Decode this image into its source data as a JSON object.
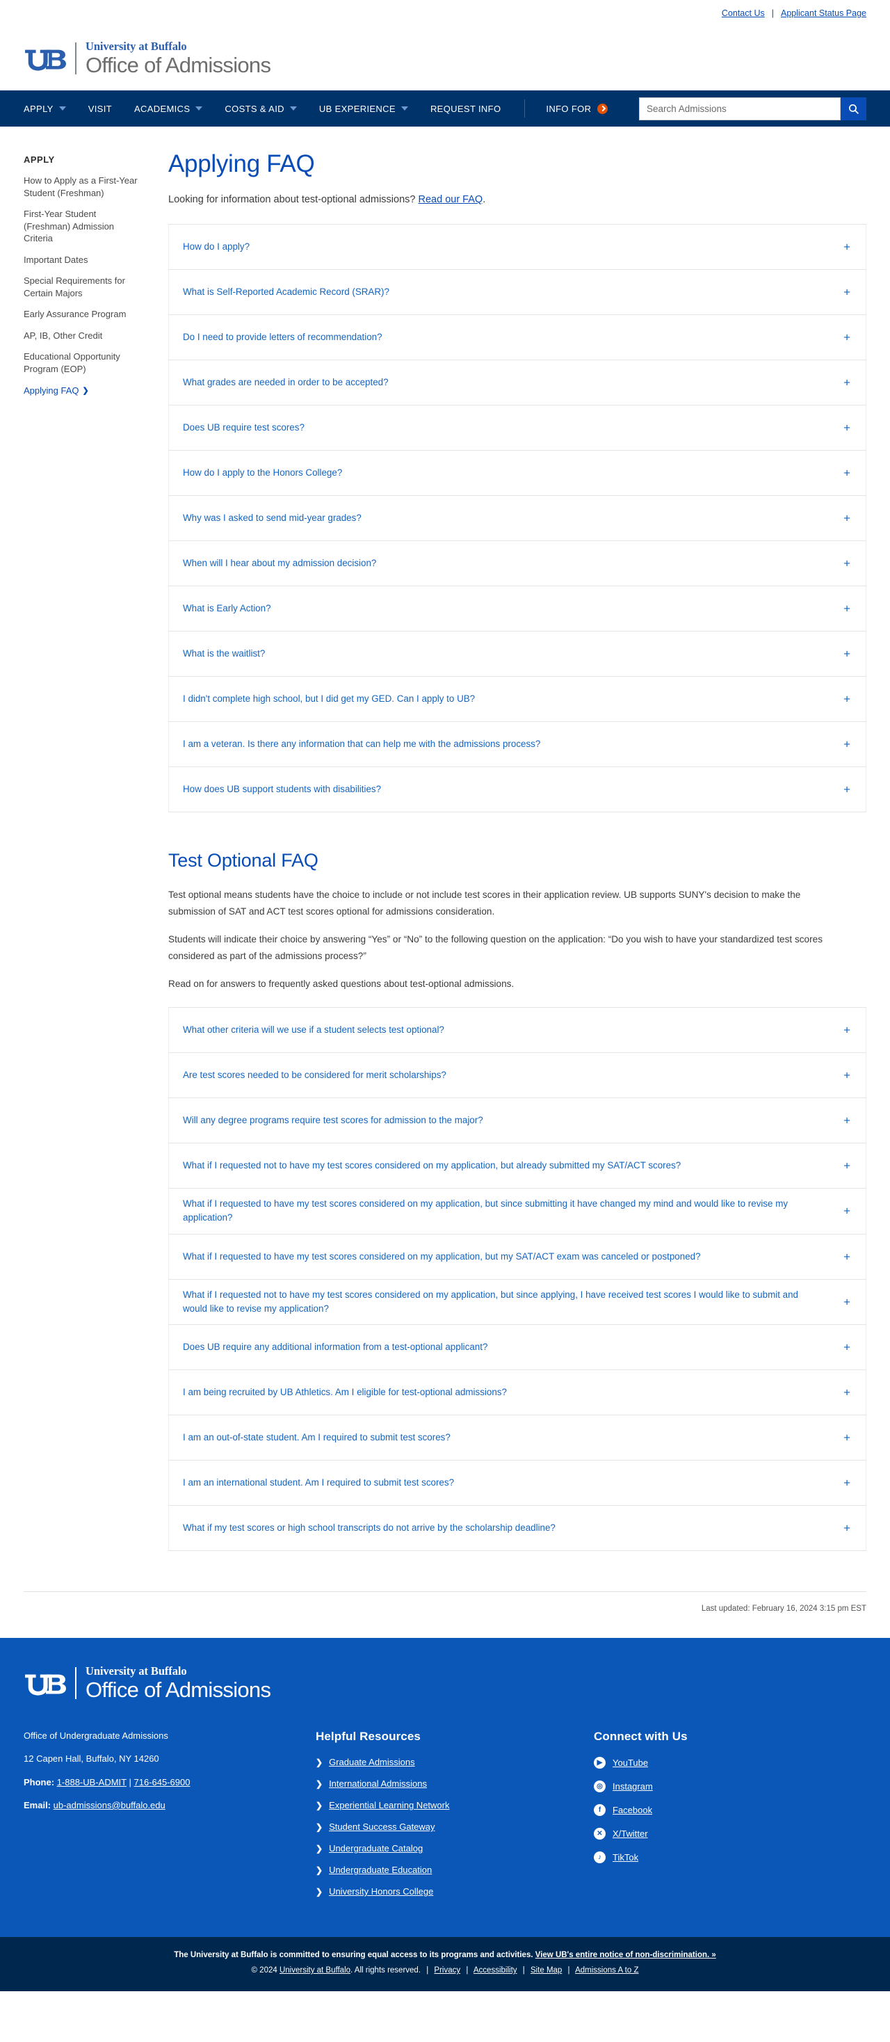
{
  "utility": {
    "contact_us": "Contact Us",
    "separator": "|",
    "applicant_status": "Applicant Status Page"
  },
  "brand": {
    "university": "University at Buffalo",
    "unit": "Office of Admissions"
  },
  "nav": {
    "items": [
      {
        "label": "APPLY",
        "has_caret": true
      },
      {
        "label": "VISIT",
        "has_caret": false
      },
      {
        "label": "ACADEMICS",
        "has_caret": true
      },
      {
        "label": "COSTS & AID",
        "has_caret": true
      },
      {
        "label": "UB EXPERIENCE",
        "has_caret": true
      },
      {
        "label": "REQUEST INFO",
        "has_caret": false
      }
    ],
    "info_for": "INFO FOR",
    "search_placeholder": "Search Admissions"
  },
  "sidebar": {
    "title": "APPLY",
    "items": [
      {
        "label": "How to Apply as a First-Year Student (Freshman)",
        "active": false
      },
      {
        "label": "First-Year Student (Freshman) Admission Criteria",
        "active": false
      },
      {
        "label": "Important Dates",
        "active": false
      },
      {
        "label": "Special Requirements for Certain Majors",
        "active": false
      },
      {
        "label": "Early Assurance Program",
        "active": false
      },
      {
        "label": "AP, IB, Other Credit",
        "active": false
      },
      {
        "label": "Educational Opportunity Program (EOP)",
        "active": false
      },
      {
        "label": "Applying FAQ",
        "active": true
      }
    ]
  },
  "main": {
    "page_title": "Applying FAQ",
    "lead_prefix": "Looking for information about test-optional admissions?",
    "lead_link": "Read our FAQ",
    "lead_suffix": ".",
    "applying_faq": [
      "How do I apply?",
      "What is Self-Reported Academic Record (SRAR)?",
      "Do I need to provide letters of recommendation?",
      "What grades are needed in order to be accepted?",
      "Does UB require test scores?",
      "How do I apply to the Honors College?",
      "Why was I asked to send mid-year grades?",
      "When will I hear about my admission decision?",
      "What is Early Action?",
      "What is the waitlist?",
      "I didn't complete high school, but I did get my GED. Can I apply to UB?",
      "I am a veteran. Is there any information that can help me with the admissions process?",
      "How does UB support students with disabilities?"
    ],
    "test_optional_title": "Test Optional FAQ",
    "test_optional_paragraphs": [
      "Test optional means students have the choice to include or not include test scores in their application review. UB supports SUNY's decision to make the submission of SAT and ACT test scores optional for admissions consideration.",
      "Students will indicate their choice by answering “Yes” or “No” to the following question on the application: “Do you wish to have your standardized test scores considered as part of the admissions process?”",
      "Read on for answers to frequently asked questions about test-optional admissions."
    ],
    "test_optional_faq": [
      "What other criteria will we use if a student selects test optional?",
      "Are test scores needed to be considered for merit scholarships?",
      "Will any degree programs require test scores for admission to the major?",
      "What if I requested not to have my test scores considered on my application, but already submitted my SAT/ACT scores?",
      "What if I requested to have my test scores considered on my application, but since submitting it have changed my mind and would like to revise my application?",
      "What if I requested to have my test scores considered on my application, but my SAT/ACT exam was canceled or postponed?",
      "What if I requested not to have my test scores considered on my application, but since applying, I have received test scores I would like to submit and would like to revise my application?",
      "Does UB require any additional information from a test-optional applicant?",
      "I am being recruited by UB Athletics. Am I eligible for test-optional admissions?",
      "I am an out-of-state student. Am I required to submit test scores?",
      "I am an international student. Am I required to submit test scores?",
      "What if my test scores or high school transcripts do not arrive by the scholarship deadline?"
    ],
    "expand_symbol": "+",
    "last_updated": "Last updated: February 16, 2024 3:15 pm EST"
  },
  "footer": {
    "contact": {
      "office": "Office of Undergraduate Admissions",
      "address": "12 Capen Hall, Buffalo, NY 14260",
      "phone_label": "Phone:",
      "phone_1": "1-888-UB-ADMIT",
      "phone_sep": "|",
      "phone_2": "716-645-6900",
      "email_label": "Email:",
      "email": "ub-admissions@buffalo.edu"
    },
    "resources": {
      "heading": "Helpful Resources",
      "links": [
        "Graduate Admissions",
        "International Admissions",
        "Experiential Learning Network",
        "Student Success Gateway",
        "Undergraduate Catalog",
        "Undergraduate Education",
        "University Honors College"
      ]
    },
    "connect": {
      "heading": "Connect with Us",
      "links": [
        {
          "label": "YouTube",
          "icon": "youtube-icon",
          "glyph": "▶"
        },
        {
          "label": "Instagram",
          "icon": "instagram-icon",
          "glyph": "◎"
        },
        {
          "label": "Facebook",
          "icon": "facebook-icon",
          "glyph": "f"
        },
        {
          "label": "X/Twitter",
          "icon": "x-twitter-icon",
          "glyph": "✕"
        },
        {
          "label": "TikTok",
          "icon": "tiktok-icon",
          "glyph": "♪"
        }
      ]
    },
    "chevron": "❯"
  },
  "bottom": {
    "line1_text": "The University at Buffalo is committed to ensuring equal access to its programs and activities.",
    "line1_link": "View UB's entire notice of non-discrimination.  »",
    "copyright": "© 2024",
    "university_link": "University at Buffalo",
    "rights": ". All rights reserved.",
    "links": [
      "Privacy",
      "Accessibility",
      "Site Map",
      "Admissions A to Z"
    ],
    "separator": "|"
  },
  "colors": {
    "nav_bg": "#00336a",
    "footer_bg": "#0a57b8",
    "bottom_bg": "#00274d",
    "link_blue": "#0a4cb5",
    "accordion_blue": "#1565c0",
    "accent_orange": "#e35205"
  }
}
